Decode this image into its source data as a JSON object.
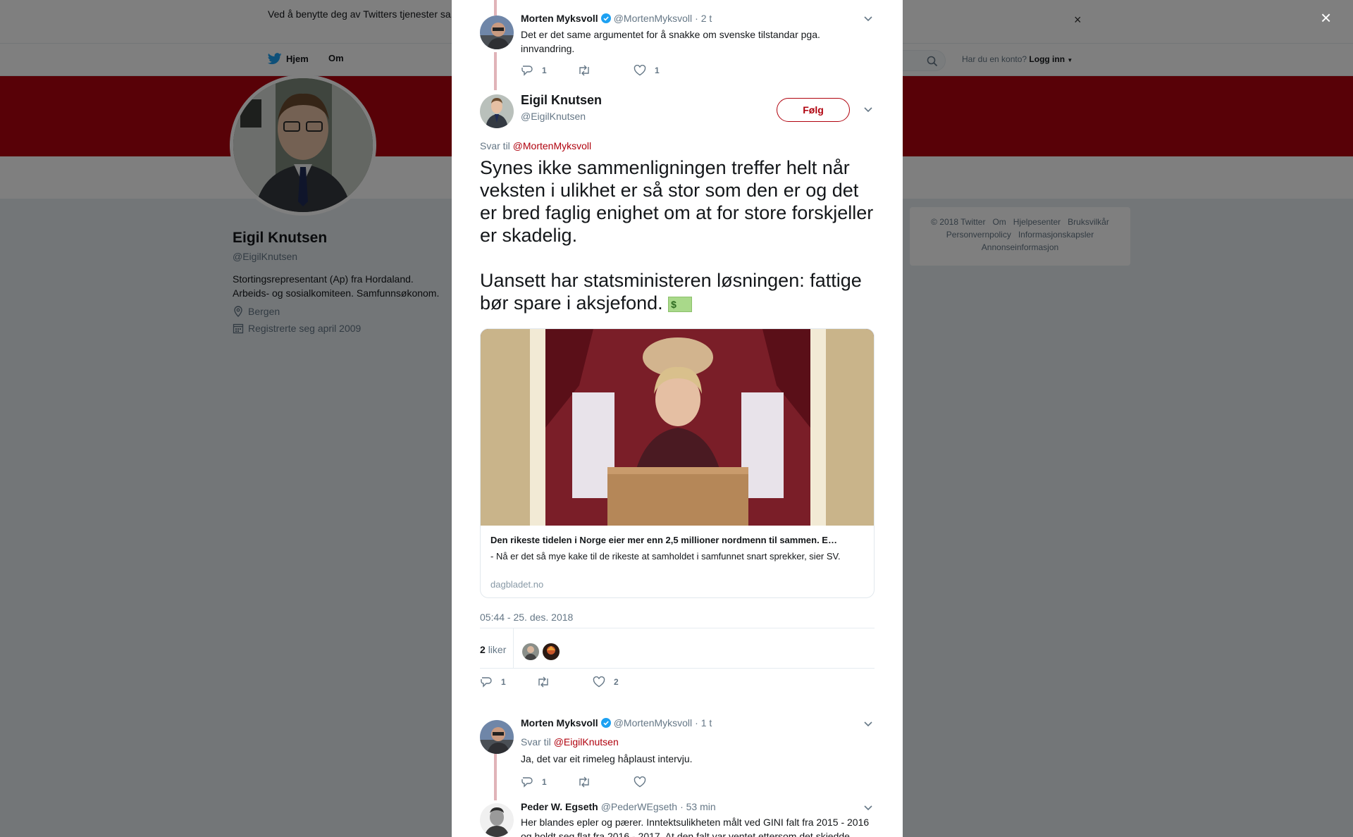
{
  "cookie_bar": {
    "text": "Ved å benytte deg av Twitters tjenester sa... informasjonskapsler til bl.a. analyser, personalisering og annonser.",
    "close": "×"
  },
  "nav": {
    "home": "Hjem",
    "about": "Om",
    "login_prompt": "Har du en konto?",
    "login": "Logg inn"
  },
  "profile": {
    "name": "Eigil Knutsen",
    "handle": "@EigilKnutsen",
    "bio": "Stortingsrepresentant (Ap) fra Hordaland. Arbeids- og sosialkomiteen. Samfunnsøkonom.",
    "location": "Bergen",
    "joined": "Registrerte seg april 2009"
  },
  "footer": {
    "links": [
      "© 2018 Twitter",
      "Om",
      "Hjelpesenter",
      "Bruksvilkår",
      "Personvernpolicy",
      "Informasjonskapsler",
      "Annonseinformasjon"
    ]
  },
  "overlay_close": "×",
  "thread": {
    "parent": {
      "name": "Morten Myksvoll",
      "handle": "@MortenMyksvoll",
      "time": "· 2 t",
      "text": "Det er det same argumentet for å snakke om svenske tilstandar pga. innvandring.",
      "replies": "1",
      "retweets": "",
      "likes": "1"
    },
    "main": {
      "name": "Eigil Knutsen",
      "handle": "@EigilKnutsen",
      "follow": "Følg",
      "reply_prefix": "Svar til",
      "reply_to": "@MortenMyksvoll",
      "paragraph1": "Synes ikke sammenligningen treffer helt når veksten i ulikhet er så stor som den er og det er bred faglig enighet om at for store forskjeller er skadelig.",
      "paragraph2": "Uansett har statsministeren løsningen: fattige bør spare i aksjefond.",
      "emoji": "$",
      "card": {
        "title": "Den rikeste tidelen i Norge eier mer enn 2,5 millioner nordmenn til sammen. E…",
        "description": "- Nå er det så mye kake til de rikeste at samholdet i samfunnet snart sprekker, sier SV.",
        "domain": "dagbladet.no"
      },
      "timestamp": "05:44 - 25. des. 2018",
      "likes_count": "2",
      "likes_label": "liker",
      "replies": "1",
      "retweets": "",
      "likes": "2"
    },
    "reply1": {
      "name": "Morten Myksvoll",
      "handle": "@MortenMyksvoll",
      "time": "· 1 t",
      "reply_prefix": "Svar til",
      "reply_to": "@EigilKnutsen",
      "text": "Ja, det var eit rimeleg håplaust intervju.",
      "replies": "1",
      "retweets": "",
      "likes": ""
    },
    "reply2": {
      "name": "Peder W. Egseth",
      "handle": "@PederWEgseth",
      "time": "· 53 min",
      "text": "Her blandes epler og pærer. Inntektsulikheten målt ved GINI falt fra 2015 - 2016 og holdt seg flat fra 2016 - 2017. At den falt var ventet ettersom det skjedde"
    }
  },
  "colors": {
    "brand_red": "#b0020e",
    "verified_blue": "#1da1f2",
    "muted": "#657786"
  }
}
